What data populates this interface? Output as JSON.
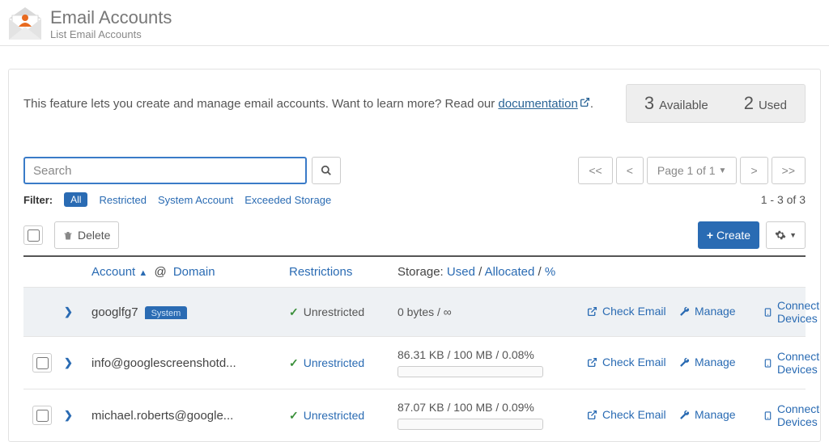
{
  "header": {
    "title": "Email Accounts",
    "subtitle": "List Email Accounts"
  },
  "intro": {
    "text_before_link": "This feature lets you create and manage email accounts. Want to learn more? Read our ",
    "link_text": "documentation",
    "text_after_link": "."
  },
  "stats": {
    "available_num": "3",
    "available_label": "Available",
    "used_num": "2",
    "used_label": "Used"
  },
  "search": {
    "placeholder": "Search"
  },
  "pagination": {
    "first": "<<",
    "prev": "<",
    "label": "Page 1 of 1",
    "next": ">",
    "last": ">>"
  },
  "filters": {
    "label": "Filter:",
    "all": "All",
    "restricted": "Restricted",
    "system": "System Account",
    "exceeded": "Exceeded Storage",
    "range": "1 - 3 of 3"
  },
  "actions": {
    "delete": "Delete",
    "create": "Create"
  },
  "columns": {
    "account": "Account",
    "at": "@",
    "domain": "Domain",
    "restrictions": "Restrictions",
    "storage_prefix": "Storage:",
    "used": "Used",
    "allocated": "Allocated",
    "percent": "%",
    "sep": "/"
  },
  "row_actions": {
    "check_email": "Check Email",
    "manage": "Manage",
    "connect": "Connect Devices"
  },
  "rows": [
    {
      "account": "googlfg7",
      "system_badge": "System",
      "restriction": "Unrestricted",
      "restriction_is_link": false,
      "storage": "0 bytes / ∞",
      "show_progress": false,
      "show_checkbox": false,
      "selected": true
    },
    {
      "account": "info@googlescreenshotd...",
      "system_badge": "",
      "restriction": "Unrestricted",
      "restriction_is_link": true,
      "storage": "86.31 KB / 100 MB / 0.08%",
      "show_progress": true,
      "show_checkbox": true,
      "selected": false
    },
    {
      "account": "michael.roberts@google...",
      "system_badge": "",
      "restriction": "Unrestricted",
      "restriction_is_link": true,
      "storage": "87.07 KB / 100 MB / 0.09%",
      "show_progress": true,
      "show_checkbox": true,
      "selected": false
    }
  ]
}
